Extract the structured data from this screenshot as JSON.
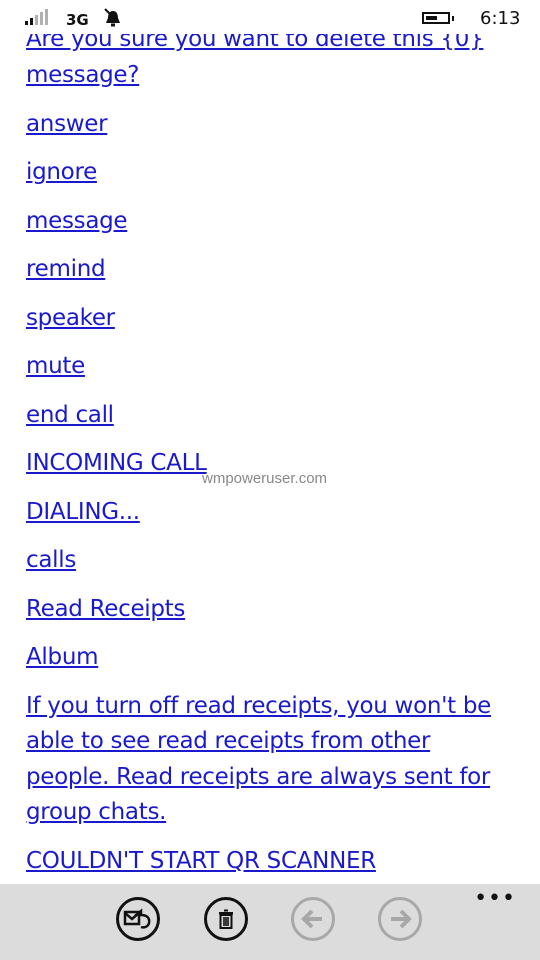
{
  "status_bar": {
    "network": "3G",
    "time": "6:13",
    "signal_bars_on": 2,
    "signal_bars_total": 5
  },
  "links": [
    "Are you sure you want to delete this {0} message?",
    "answer",
    "ignore",
    "message",
    "remind",
    "speaker",
    "mute",
    "end call",
    "INCOMING CALL",
    "DIALING...",
    "calls",
    "Read Receipts",
    "Album",
    "If you turn off read receipts, you won't be able to see read receipts from other people. Read receipts are always sent for group chats.",
    "COULDN'T START QR SCANNER"
  ],
  "watermark": "wmpoweruser.com",
  "app_bar": {
    "buttons": [
      {
        "icon": "reply-mail-icon",
        "enabled": true
      },
      {
        "icon": "delete-icon",
        "enabled": true
      },
      {
        "icon": "back-arrow-icon",
        "enabled": false
      },
      {
        "icon": "forward-arrow-icon",
        "enabled": false
      }
    ],
    "more": "•••"
  },
  "colors": {
    "link": "#1a1acc",
    "app_bar_bg": "#dcdcdc",
    "disabled": "#a8a8a8"
  }
}
